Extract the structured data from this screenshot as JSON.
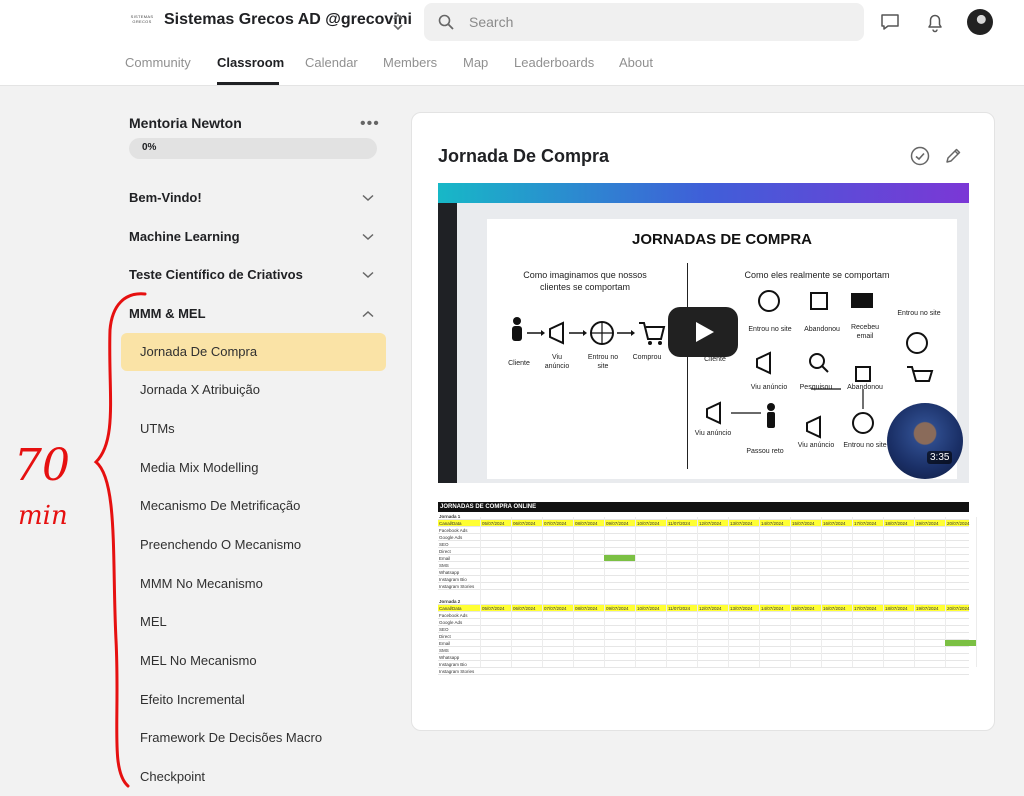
{
  "header": {
    "logo_text": "SISTEMAS GRECOS",
    "group_name": "Sistemas Grecos AD @grecovini",
    "search_placeholder": "Search",
    "icons": [
      "chat-icon",
      "bell-icon",
      "avatar"
    ]
  },
  "nav": {
    "tabs": [
      {
        "label": "Community"
      },
      {
        "label": "Classroom",
        "active": true
      },
      {
        "label": "Calendar"
      },
      {
        "label": "Members"
      },
      {
        "label": "Map"
      },
      {
        "label": "Leaderboards"
      },
      {
        "label": "About"
      }
    ]
  },
  "sidebar": {
    "course_title": "Mentoria Newton",
    "more_label": "•••",
    "progress": {
      "label": "0%",
      "fraction": 0
    },
    "sections": [
      {
        "label": "Bem-Vindo!",
        "expanded": false
      },
      {
        "label": "Machine Learning",
        "expanded": false
      },
      {
        "label": "Teste Científico de Criativos",
        "expanded": false
      },
      {
        "label": "MMM & MEL",
        "expanded": true
      }
    ],
    "lessons": [
      {
        "label": "Jornada De Compra",
        "active": true
      },
      {
        "label": "Jornada X Atribuição"
      },
      {
        "label": "UTMs"
      },
      {
        "label": "Media Mix Modelling"
      },
      {
        "label": "Mecanismo De Metrificação"
      },
      {
        "label": "Preenchendo O Mecanismo"
      },
      {
        "label": "MMM No Mecanismo"
      },
      {
        "label": "MEL"
      },
      {
        "label": "MEL No Mecanismo"
      },
      {
        "label": "Efeito Incremental"
      },
      {
        "label": "Framework De Decisões Macro"
      },
      {
        "label": "Checkpoint"
      }
    ],
    "annotation": {
      "line1": "70",
      "line2": "min"
    }
  },
  "content": {
    "title": "Jornada De Compra",
    "video": {
      "duration": "3:35",
      "slide": {
        "title": "JORNADAS DE COMPRA",
        "left_caption": "Como imaginamos que nossos clientes se comportam",
        "right_caption": "Como eles realmente se comportam",
        "left_steps": [
          "Cliente",
          "Viu anúncio",
          "Entrou no site",
          "Comprou"
        ],
        "right_labels": [
          "Entrou no site",
          "Abandonou",
          "Recebeu email",
          "Entrou no site",
          "Cliente",
          "Viu anúncio",
          "Pesquisou",
          "Abandonou",
          "Viu anúncio",
          "Passou reto",
          "Viu anúncio",
          "Entrou no site"
        ]
      }
    },
    "sheet": {
      "title": "JORNADAS DE COMPRA ONLINE",
      "journey1": "Jornada 1",
      "journey2": "Jornada 2",
      "channel_header": "Canal/Data",
      "dates": [
        "05/07/2024",
        "06/07/2024",
        "07/07/2024",
        "08/07/2024",
        "09/07/2024",
        "10/07/2024",
        "11/07/2024",
        "12/07/2024",
        "13/07/2024",
        "14/07/2024",
        "15/07/2024",
        "16/07/2024",
        "17/07/2024",
        "18/07/2024",
        "19/07/2024",
        "20/07/2024"
      ],
      "channels": [
        "Facebook Ads",
        "Google Ads",
        "SEO",
        "Direct",
        "Email",
        "SMS",
        "Whatsapp",
        "Instagram Bio",
        "Instagram Stories"
      ]
    }
  }
}
